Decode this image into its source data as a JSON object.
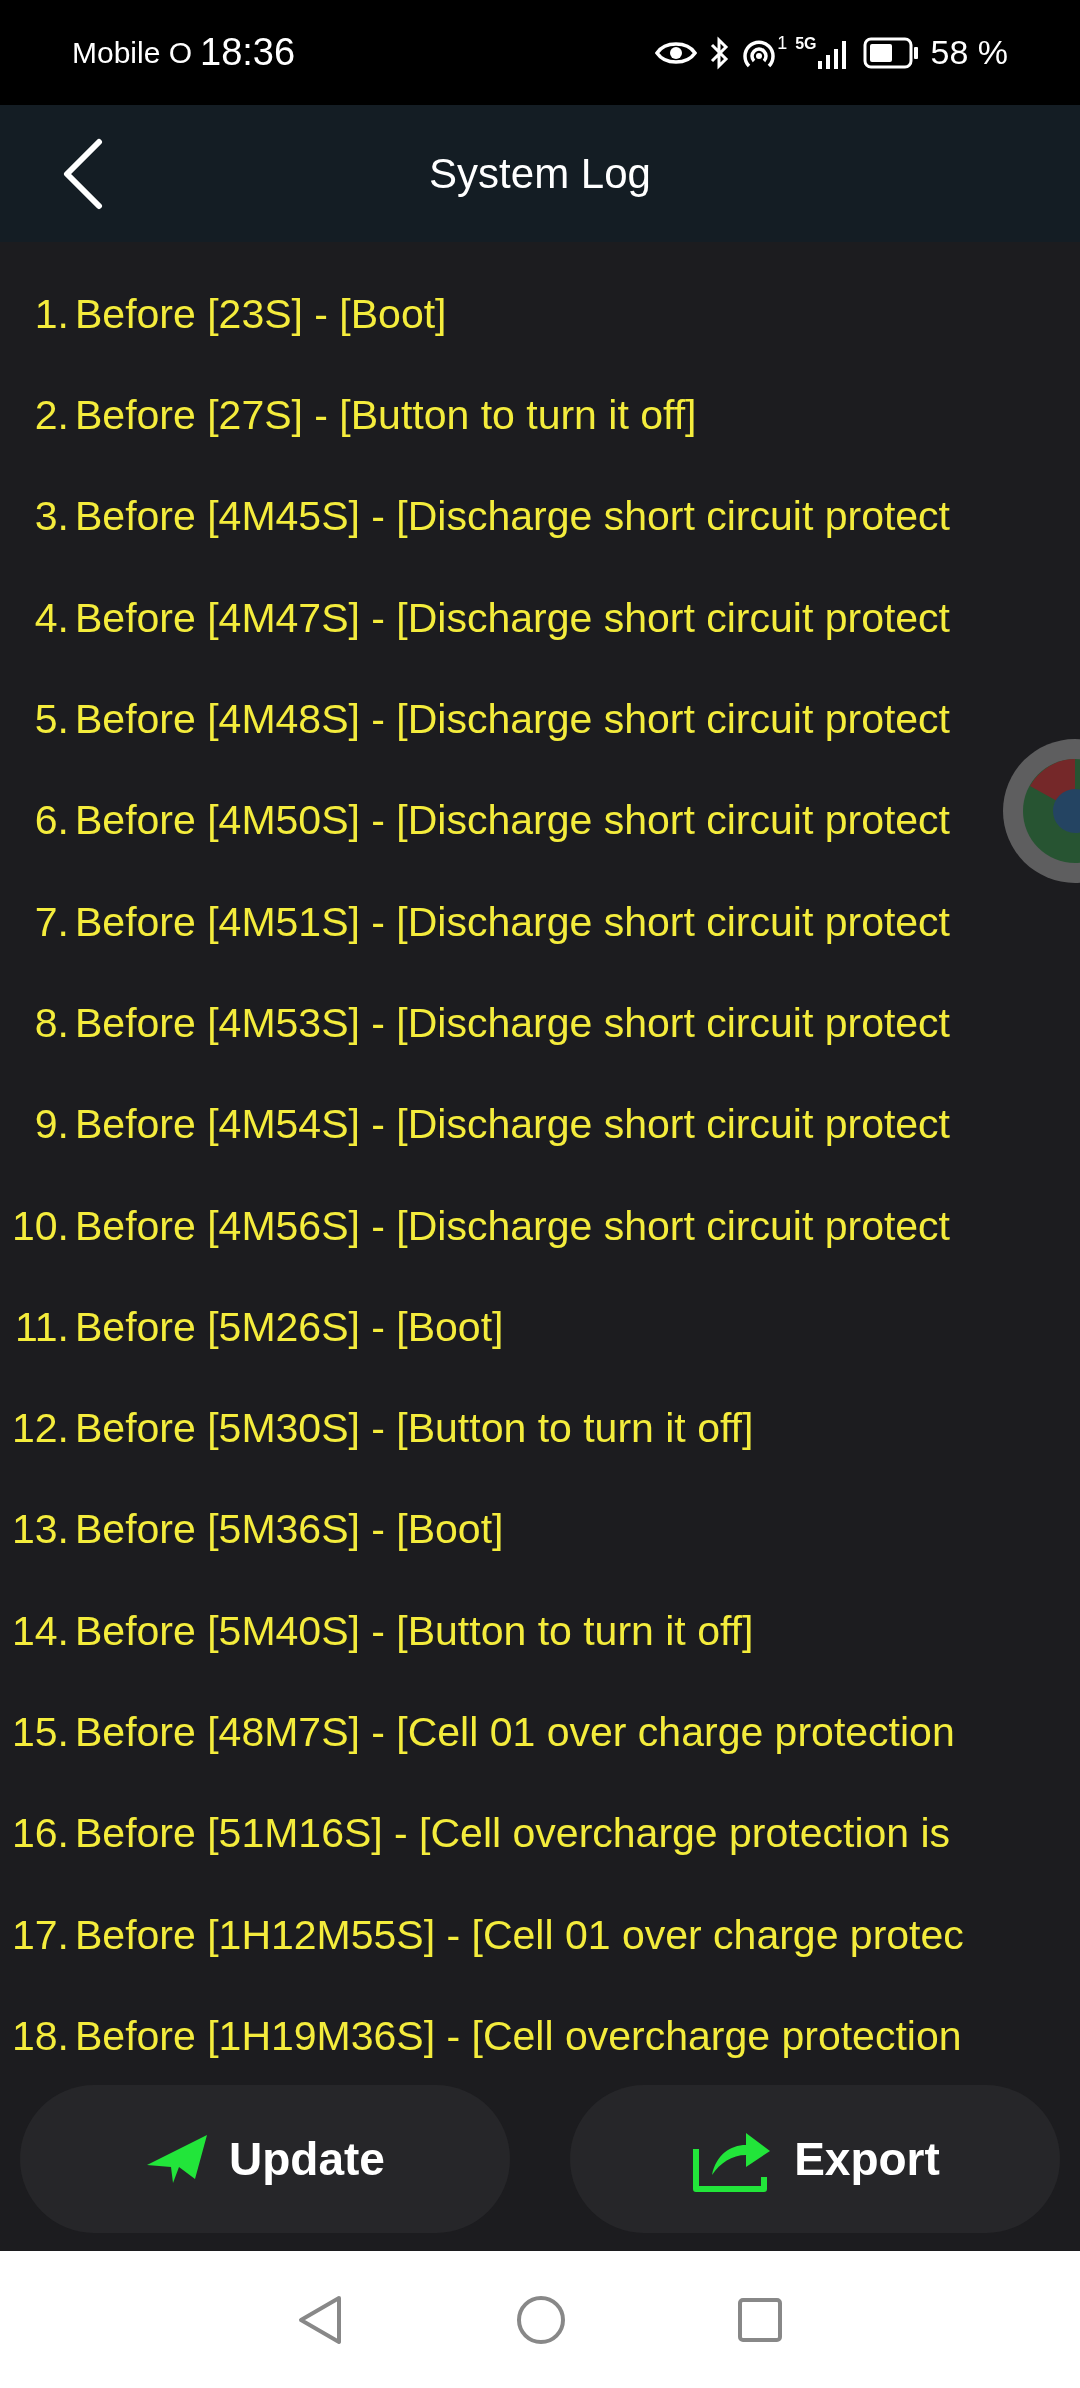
{
  "status_bar": {
    "carrier": "Mobile O",
    "time": "18:36",
    "network_sup": "1",
    "network_type": "5G",
    "battery_text": "58 %"
  },
  "header": {
    "title": "System Log"
  },
  "log_entries": [
    {
      "number": "1.",
      "text": "Before [23S] - [Boot]"
    },
    {
      "number": "2.",
      "text": "Before [27S] - [Button to turn it off]"
    },
    {
      "number": "3.",
      "text": "Before [4M45S] - [Discharge short circuit protect"
    },
    {
      "number": "4.",
      "text": "Before [4M47S] - [Discharge short circuit protect"
    },
    {
      "number": "5.",
      "text": "Before [4M48S] - [Discharge short circuit protect"
    },
    {
      "number": "6.",
      "text": "Before [4M50S] - [Discharge short circuit protect"
    },
    {
      "number": "7.",
      "text": "Before [4M51S] - [Discharge short circuit protect"
    },
    {
      "number": "8.",
      "text": "Before [4M53S] - [Discharge short circuit protect"
    },
    {
      "number": "9.",
      "text": "Before [4M54S] - [Discharge short circuit protect"
    },
    {
      "number": "10.",
      "text": "Before [4M56S] - [Discharge short circuit protect"
    },
    {
      "number": "11.",
      "text": "Before [5M26S] - [Boot]"
    },
    {
      "number": "12.",
      "text": "Before [5M30S] - [Button to turn it off]"
    },
    {
      "number": "13.",
      "text": "Before [5M36S] - [Boot]"
    },
    {
      "number": "14.",
      "text": "Before [5M40S] - [Button to turn it off]"
    },
    {
      "number": "15.",
      "text": "Before [48M7S] - [Cell 01 over charge protection"
    },
    {
      "number": "16.",
      "text": "Before [51M16S] - [Cell overcharge protection is"
    },
    {
      "number": "17.",
      "text": "Before [1H12M55S] - [Cell 01 over charge protec"
    },
    {
      "number": "18.",
      "text": "Before [1H19M36S] - [Cell overcharge protection"
    }
  ],
  "buttons": [
    {
      "kind": "update",
      "label": "Update"
    },
    {
      "kind": "export",
      "label": "Export"
    }
  ]
}
